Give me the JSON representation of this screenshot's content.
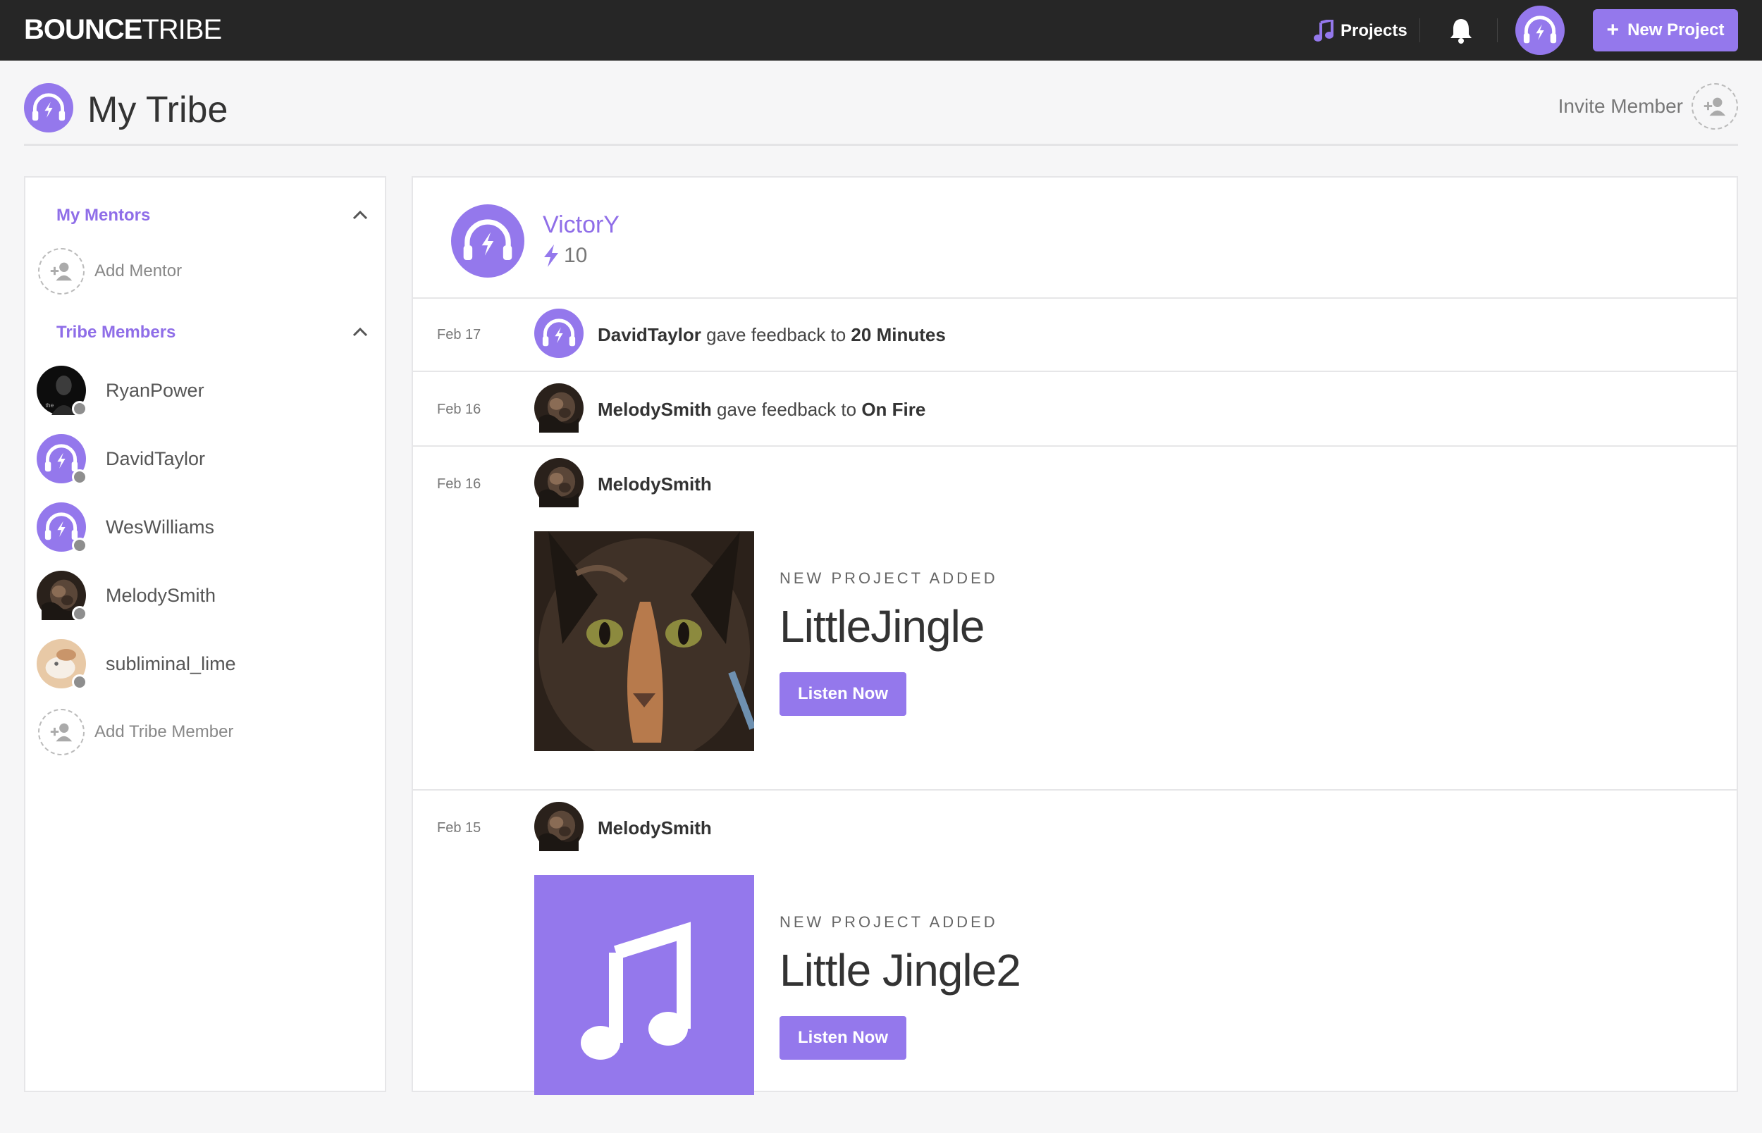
{
  "app": {
    "logo_bold": "BOUNCE",
    "logo_light": "TRIBE"
  },
  "topnav": {
    "projects_label": "Projects",
    "new_project_label": "New Project"
  },
  "page": {
    "title": "My Tribe",
    "invite_label": "Invite Member"
  },
  "sidebar": {
    "mentors_heading": "My Mentors",
    "add_mentor_label": "Add Mentor",
    "members_heading": "Tribe Members",
    "members": [
      {
        "name": "RyanPower"
      },
      {
        "name": "DavidTaylor"
      },
      {
        "name": "WesWilliams"
      },
      {
        "name": "MelodySmith"
      },
      {
        "name": "subliminal_lime"
      }
    ],
    "add_member_label": "Add Tribe Member"
  },
  "profile": {
    "username": "VictorY",
    "score": "10"
  },
  "feed": [
    {
      "date": "Feb 17",
      "user": "DavidTaylor",
      "action": "gave feedback to",
      "target": "20 Minutes"
    },
    {
      "date": "Feb 16",
      "user": "MelodySmith",
      "action": "gave feedback to",
      "target": "On Fire"
    },
    {
      "date": "Feb 16",
      "user": "MelodySmith",
      "label": "NEW PROJECT ADDED",
      "project": "LittleJingle",
      "button": "Listen Now"
    },
    {
      "date": "Feb 15",
      "user": "MelodySmith",
      "label": "NEW PROJECT ADDED",
      "project": "Little Jingle2",
      "button": "Listen Now"
    }
  ],
  "colors": {
    "accent": "#9478ec",
    "topbar": "#262626",
    "status_dot": "#8e8e8e"
  }
}
